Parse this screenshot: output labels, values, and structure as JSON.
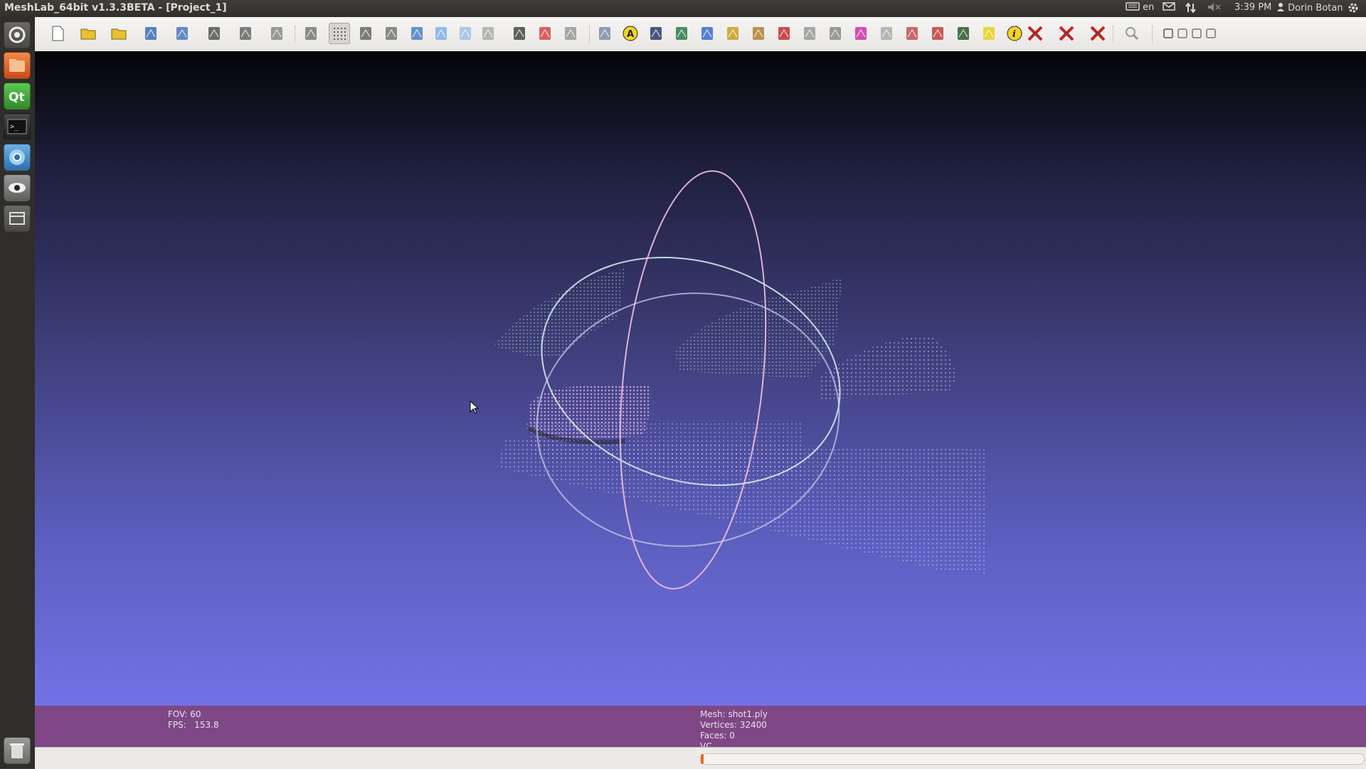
{
  "window": {
    "title": "MeshLab_64bit v1.3.3BETA - [Project_1]"
  },
  "top_panel": {
    "keyboard_layout": "en",
    "clock": "3:39 PM",
    "user": "Dorin Botan"
  },
  "launcher": {
    "items": [
      {
        "name": "dash-home-icon",
        "color": "#5a5955"
      },
      {
        "name": "files-icon",
        "color": "#e4672e"
      },
      {
        "name": "qt-creator-icon",
        "color": "#41b23b"
      },
      {
        "name": "terminal-icon",
        "color": "#2a2a2a"
      },
      {
        "name": "chromium-icon",
        "color": "#3b86c7"
      },
      {
        "name": "meshlab-icon",
        "color": "#7b7b7b"
      },
      {
        "name": "workspace-switcher-icon",
        "color": "#5a5955"
      },
      {
        "name": "trash-icon",
        "color": "#8a8a86"
      }
    ]
  },
  "toolbar": {
    "active_tool": "render-points-icon",
    "tools": [
      "new-project-icon",
      "open-project-icon",
      "open-mesh-icon",
      "reload-icon",
      "save-snapshot-icon",
      "snapshot-camera-icon",
      "layers-icon",
      "filter-icon",
      "bounding-box-icon",
      "render-points-icon",
      "render-wireframe-icon",
      "render-hidden-lines-icon",
      "render-flat-icon",
      "render-flat-lines-icon",
      "render-smooth-icon",
      "render-texture-icon",
      "light-icon",
      "backface-icon",
      "double-side-icon",
      "trackball-icon",
      "annotation-icon",
      "alignment-icon",
      "quality-icon",
      "measure-icon",
      "paint-icon",
      "brush-icon",
      "pickpoints-icon",
      "select-vertexes-icon",
      "select-faces-icon",
      "select-connected-icon",
      "select-region-icon",
      "manipulate-icon",
      "reference-icon",
      "edit-icon",
      "texture-icon",
      "info-icon",
      "delete-selected-icon",
      "delete-faces-icon",
      "delete-vertices-icon",
      "zoom-icon",
      "window-eye-icon",
      "window-minimize-icon",
      "window-restore-icon",
      "window-close-icon"
    ]
  },
  "info_left": {
    "fov": "FOV: 60",
    "fps": "FPS:   153.8"
  },
  "info_right": {
    "mesh": "Mesh: shot1.ply",
    "vertices": "Vertices: 32400",
    "faces": "Faces: 0",
    "vc": "VC"
  },
  "progress": {
    "value_percent": 0.4,
    "color": "#e86a2c"
  },
  "colors": {
    "info_bar": "#7f4785",
    "viewport_top": "#050508",
    "viewport_bottom": "#7272e6"
  }
}
